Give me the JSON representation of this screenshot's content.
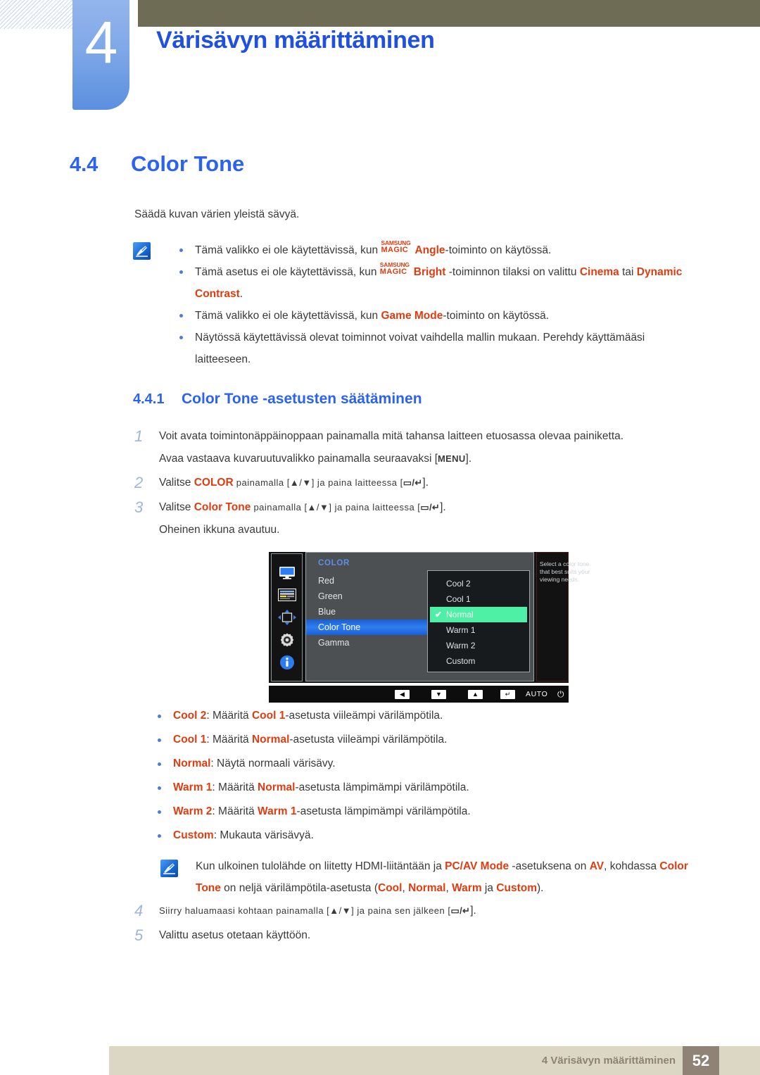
{
  "header": {
    "chapter_number": "4",
    "chapter_title": "Värisävyn määrittäminen",
    "colors": {
      "tab": "#7fa8e8",
      "band": "#6f6c55",
      "title": "#1f50e0"
    }
  },
  "section": {
    "number": "4.4",
    "title": "Color Tone",
    "intro": "Säädä kuvan värien yleistä sävyä."
  },
  "note1": {
    "icon": "note-pencil-icon",
    "bullets": [
      {
        "pre": "Tämä valikko ei ole käytettävissä, kun ",
        "magic_top": "SAMSUNG",
        "magic_bottom": "MAGIC",
        "highlight": "Angle",
        "post": "-toiminto on käytössä."
      },
      {
        "pre": "Tämä asetus ei ole käytettävissä, kun ",
        "magic_top": "SAMSUNG",
        "magic_bottom": "MAGIC",
        "highlight": "Bright",
        "mid": " -toiminnon tilaksi on valittu ",
        "highlight2": "Cinema",
        "mid2": " tai ",
        "highlight3": "Dynamic Contrast",
        "post": "."
      },
      {
        "pre": "Tämä valikko ei ole käytettävissä, kun ",
        "highlight": "Game Mode",
        "post": "-toiminto on käytössä."
      },
      {
        "pre": "Näytössä käytettävissä olevat toiminnot voivat vaihdella mallin mukaan. Perehdy käyttämääsi laitteeseen."
      }
    ]
  },
  "subsection": {
    "number": "4.4.1",
    "title": "Color Tone -asetusten säätäminen"
  },
  "steps": [
    {
      "number": "1",
      "line1": "Voit avata toimintonäppäinoppaan painamalla mitä tahansa laitteen etuosassa olevaa painiketta.",
      "line2_pre": "Avaa vastaava kuvaruutuvalikko painamalla seuraavaksi [",
      "line2_key": "MENU",
      "line2_post": "]."
    },
    {
      "number": "2",
      "pre": "Valitse ",
      "highlight": "COLOR",
      "mid": " painamalla [▲/▼] ja paina laitteessa [",
      "key2": "▭/↵",
      "post": "]."
    },
    {
      "number": "3",
      "pre": "Valitse ",
      "highlight": "Color Tone",
      "mid": " painamalla [▲/▼] ja paina laitteessa [",
      "key2": "▭/↵",
      "post": "].",
      "note": "Oheinen ikkuna avautuu."
    }
  ],
  "osd": {
    "menu_title": "COLOR",
    "sidebar_icons": [
      "display-icon",
      "picture-icon",
      "position-icon",
      "setup-gear-icon",
      "information-icon"
    ],
    "menu_items": [
      {
        "label": "Red",
        "selected": false
      },
      {
        "label": "Green",
        "selected": false
      },
      {
        "label": "Blue",
        "selected": false
      },
      {
        "label": "Color Tone",
        "selected": true
      },
      {
        "label": "Gamma",
        "selected": false
      }
    ],
    "submenu_options": [
      {
        "label": "Cool 2",
        "selected": false
      },
      {
        "label": "Cool 1",
        "selected": false
      },
      {
        "label": "Normal",
        "selected": true
      },
      {
        "label": "Warm 1",
        "selected": false
      },
      {
        "label": "Warm 2",
        "selected": false
      },
      {
        "label": "Custom",
        "selected": false
      }
    ],
    "help_text": "Select a color tone that best suits your viewing needs.",
    "bottom_buttons": [
      {
        "glyph": "◀",
        "name": "left-button"
      },
      {
        "glyph": "▼",
        "name": "down-button"
      },
      {
        "glyph": "▲",
        "name": "up-button"
      },
      {
        "glyph": "↵",
        "name": "enter-button"
      }
    ],
    "auto_label": "AUTO",
    "power_glyph": "⏻",
    "colors": {
      "selected_row": "#2f7ef0",
      "selected_option": "#4ef0a5",
      "title": "#5d8fe8"
    }
  },
  "options": [
    {
      "term": "Cool 2",
      "sep": ": Määritä ",
      "ref": "Cool 1",
      "desc": "-asetusta viileämpi värilämpötila."
    },
    {
      "term": "Cool 1",
      "sep": ": Määritä ",
      "ref": "Normal",
      "desc": "-asetusta viileämpi värilämpötila."
    },
    {
      "term": "Normal",
      "sep": ": Näytä normaali värisävy.",
      "ref": "",
      "desc": ""
    },
    {
      "term": "Warm 1",
      "sep": ": Määritä ",
      "ref": "Normal",
      "desc": "-asetusta lämpimämpi värilämpötila."
    },
    {
      "term": "Warm 2",
      "sep": ": Määritä ",
      "ref": "Warm 1",
      "desc": "-asetusta lämpimämpi värilämpötila."
    },
    {
      "term": "Custom",
      "sep": ": Mukauta värisävyä.",
      "ref": "",
      "desc": ""
    }
  ],
  "note2": {
    "icon": "note-pencil-icon",
    "p1": "Kun ulkoinen tulolähde on liitetty HDMI-liitäntään ja ",
    "h1": "PC/AV Mode",
    "p2": " -asetuksena on ",
    "h2": "AV",
    "p3": ", kohdassa ",
    "h3": "Color Tone",
    "p4": " on neljä värilämpötila-asetusta (",
    "h4": "Cool",
    "p5": ", ",
    "h5": "Normal",
    "p6": ", ",
    "h6": "Warm",
    "p7": " ja ",
    "h7": "Custom",
    "p8": ")."
  },
  "steps2": [
    {
      "number": "4",
      "pre": "Siirry haluamaasi kohtaan painamalla [▲/▼] ja paina sen jälkeen [",
      "key2": "▭/↵",
      "post": "]."
    },
    {
      "number": "5",
      "pre": "Valittu asetus otetaan käyttöön.",
      "key2": "",
      "post": ""
    }
  ],
  "footer": {
    "text": "4 Värisävyn määrittäminen",
    "page": "52",
    "colors": {
      "band": "#dcd7c4",
      "page_box": "#8f8375"
    }
  }
}
